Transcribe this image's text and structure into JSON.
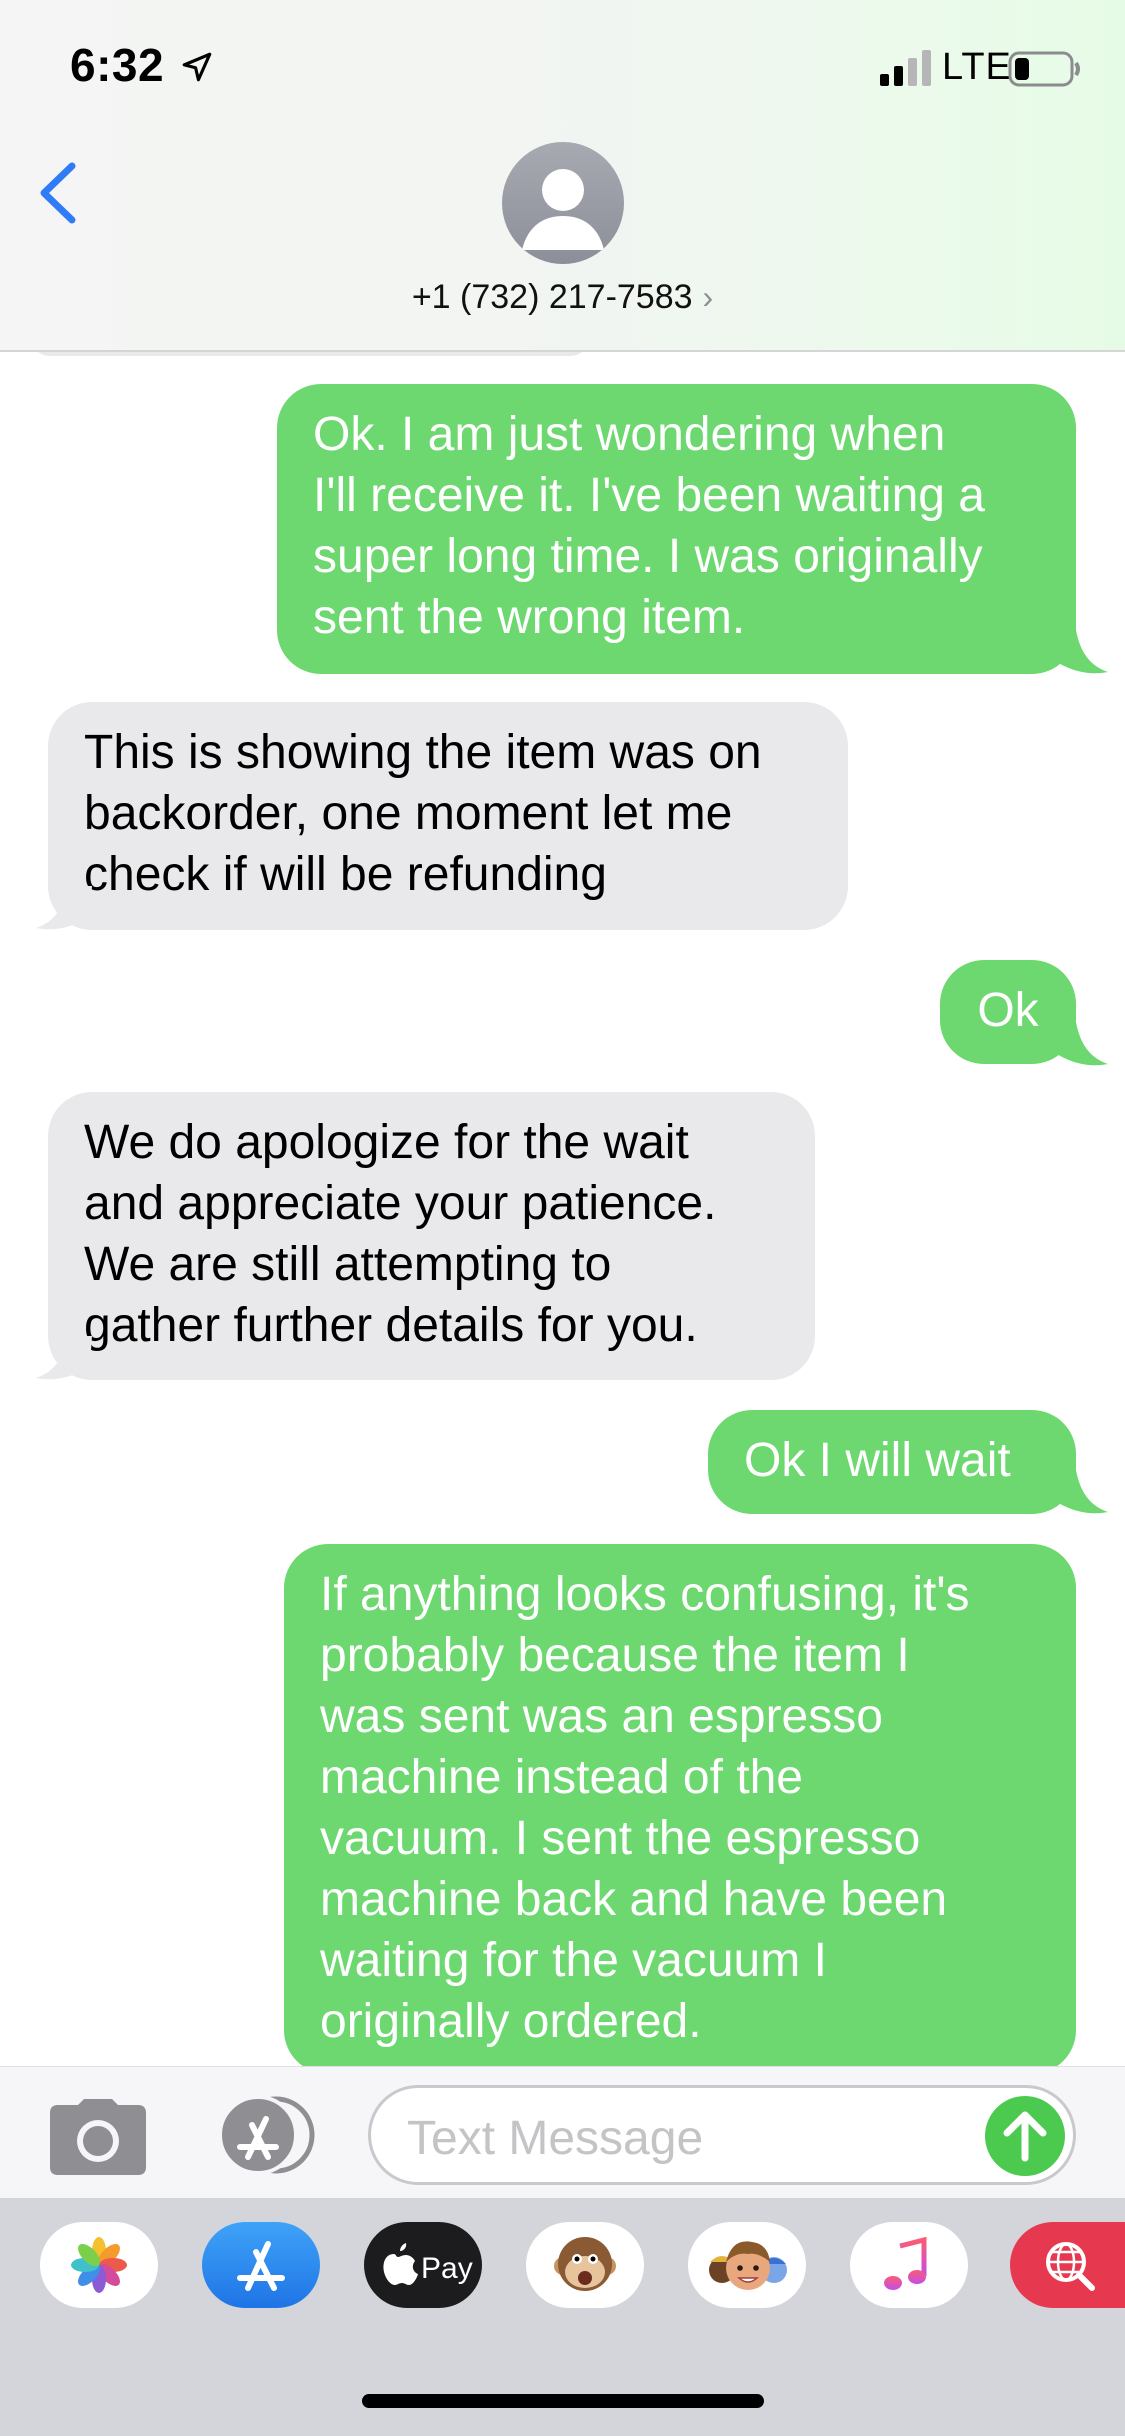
{
  "status_bar": {
    "time": "6:32",
    "network": "LTE"
  },
  "header": {
    "contact": "+1 (732) 217-7583"
  },
  "messages": [
    {
      "direction": "sent",
      "text": "Ok. I am just wondering when\nI'll receive it. I've been waiting a\nsuper long time. I was originally\nsent the wrong item."
    },
    {
      "direction": "received",
      "text": "This is showing the item was on\nbackorder, one moment let me\ncheck if will be refunding"
    },
    {
      "direction": "sent",
      "text": "Ok"
    },
    {
      "direction": "received",
      "text": "We do apologize for the wait\nand appreciate your patience.\nWe are still attempting to\ngather further details for you."
    },
    {
      "direction": "sent",
      "text": "Ok I will wait"
    },
    {
      "direction": "sent",
      "text": "If anything looks confusing, it's\nprobably because the item I\nwas sent was an espresso\nmachine instead of the\nvacuum. I sent the espresso\nmachine back and have been\nwaiting for the vacuum  I\noriginally ordered."
    }
  ],
  "compose": {
    "placeholder": "Text Message"
  },
  "app_drawer": {
    "apple_pay_label": "Pay",
    "apps": [
      "photos-icon",
      "app-store-icon",
      "apple-pay-icon",
      "animoji-icon",
      "memoji-icon",
      "music-icon",
      "web-search-icon"
    ]
  },
  "colors": {
    "sent_bubble": "#6cd86f",
    "received_bubble": "#e9e9eb",
    "accent_blue": "#2f7cf6",
    "send_button": "#4cc94f"
  }
}
